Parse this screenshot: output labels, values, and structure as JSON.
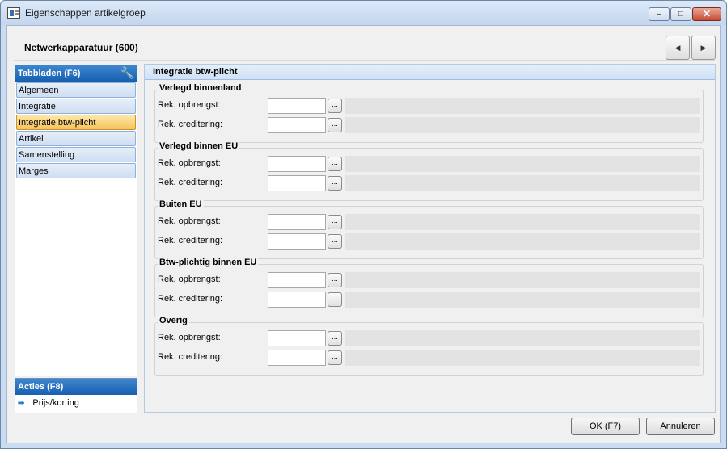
{
  "window": {
    "title": "Eigenschappen artikelgroep",
    "minimize": "–",
    "maximize": "□",
    "close": "✕"
  },
  "header": {
    "title": "Netwerkapparatuur (600)",
    "prev_icon": "◀",
    "next_icon": "▶"
  },
  "sidebar": {
    "title": "Tabbladen (F6)",
    "tool_icon": "🔧",
    "tabs": [
      {
        "label": "Algemeen"
      },
      {
        "label": "Integratie"
      },
      {
        "label": "Integratie btw-plicht"
      },
      {
        "label": "Artikel"
      },
      {
        "label": "Samenstelling"
      },
      {
        "label": "Marges"
      }
    ],
    "active_index": 2
  },
  "actions": {
    "title": "Acties (F8)",
    "arrow_icon": "➡",
    "items": [
      {
        "label": "Prijs/korting"
      }
    ]
  },
  "panel": {
    "title": "Integratie btw-plicht",
    "lookup_label": "...",
    "groups": [
      {
        "title": "Verlegd binnenland",
        "row1": "Rek. opbrengst:",
        "row2": "Rek. creditering:"
      },
      {
        "title": "Verlegd binnen EU",
        "row1": "Rek. opbrengst:",
        "row2": "Rek. creditering:"
      },
      {
        "title": "Buiten EU",
        "row1": "Rek. opbrengst:",
        "row2": "Rek. creditering:"
      },
      {
        "title": "Btw-plichtig binnen EU",
        "row1": "Rek. opbrengst:",
        "row2": "Rek. creditering:"
      },
      {
        "title": "Overig",
        "row1": "Rek. opbrengst:",
        "row2": "Rek. creditering:"
      }
    ]
  },
  "footer": {
    "ok_label": "OK (F7)",
    "cancel_label": "Annuleren"
  },
  "colors": {
    "accent": "#1660b0",
    "active_tab": "#f6c35a"
  }
}
